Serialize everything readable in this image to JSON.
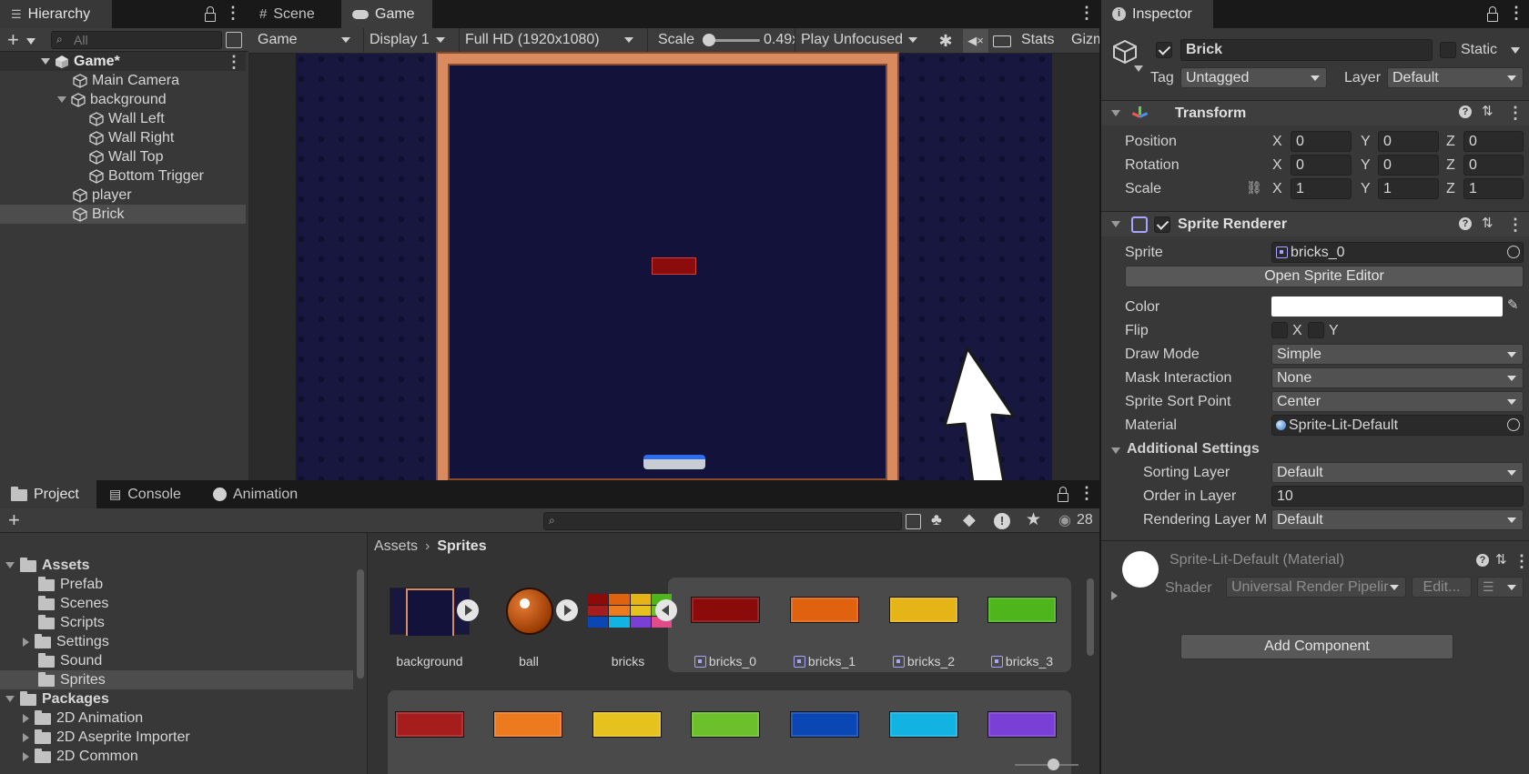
{
  "hierarchy": {
    "tab": "Hierarchy",
    "search_placeholder": "All",
    "items": [
      {
        "label": "Game*"
      },
      {
        "label": "Main Camera"
      },
      {
        "label": "background"
      },
      {
        "label": "Wall Left"
      },
      {
        "label": "Wall Right"
      },
      {
        "label": "Wall Top"
      },
      {
        "label": "Bottom Trigger"
      },
      {
        "label": "player"
      },
      {
        "label": "Brick"
      }
    ]
  },
  "game_view": {
    "tabs": [
      "Scene",
      "Game"
    ],
    "toolbar": {
      "view_mode": "Game",
      "display": "Display 1",
      "resolution": "Full HD (1920x1080)",
      "scale_label": "Scale",
      "scale_value": "0.49x",
      "play_mode": "Play Unfocused",
      "stats": "Stats",
      "gizmos": "Gizm"
    }
  },
  "project": {
    "tabs": [
      "Project",
      "Console",
      "Animation"
    ],
    "visible_count": "28",
    "tree": [
      {
        "label": "Assets"
      },
      {
        "label": "Prefab"
      },
      {
        "label": "Scenes"
      },
      {
        "label": "Scripts"
      },
      {
        "label": "Settings"
      },
      {
        "label": "Sound"
      },
      {
        "label": "Sprites"
      },
      {
        "label": "Packages"
      },
      {
        "label": "2D Animation"
      },
      {
        "label": "2D Aseprite Importer"
      },
      {
        "label": "2D Common"
      }
    ],
    "breadcrumb": {
      "root": "Assets",
      "current": "Sprites"
    },
    "assets": [
      {
        "label": "background"
      },
      {
        "label": "ball"
      },
      {
        "label": "bricks"
      },
      {
        "label": "bricks_0"
      },
      {
        "label": "bricks_1"
      },
      {
        "label": "bricks_2"
      },
      {
        "label": "bricks_3"
      }
    ],
    "brick_colors": [
      "#8b0a0a",
      "#e0620f",
      "#e5b417",
      "#4eb51c"
    ],
    "brick_colors_row2": [
      "#a51d1d",
      "#ee7a1f",
      "#e6c21f",
      "#6cc02c",
      "#0a47b5",
      "#12b3e2",
      "#7a3fd4"
    ]
  },
  "inspector": {
    "tab": "Inspector",
    "object_name": "Brick",
    "static_label": "Static",
    "tag_label": "Tag",
    "tag_value": "Untagged",
    "layer_label": "Layer",
    "layer_value": "Default",
    "transform": {
      "title": "Transform",
      "position_label": "Position",
      "rotation_label": "Rotation",
      "scale_label": "Scale",
      "position": {
        "x": "0",
        "y": "0",
        "z": "0"
      },
      "rotation": {
        "x": "0",
        "y": "0",
        "z": "0"
      },
      "scale": {
        "x": "1",
        "y": "1",
        "z": "1"
      }
    },
    "sprite_renderer": {
      "title": "Sprite Renderer",
      "sprite_label": "Sprite",
      "sprite_value": "bricks_0",
      "open_editor": "Open Sprite Editor",
      "color_label": "Color",
      "color_value": "#ffffff",
      "flip_label": "Flip",
      "flip_x": "X",
      "flip_y": "Y",
      "draw_mode_label": "Draw Mode",
      "draw_mode": "Simple",
      "mask_label": "Mask Interaction",
      "mask": "None",
      "sort_point_label": "Sprite Sort Point",
      "sort_point": "Center",
      "material_label": "Material",
      "material": "Sprite-Lit-Default",
      "additional_title": "Additional Settings",
      "sorting_layer_label": "Sorting Layer",
      "sorting_layer": "Default",
      "order_label": "Order in Layer",
      "order": "10",
      "rendering_label": "Rendering Layer M",
      "rendering": "Default"
    },
    "material": {
      "title": "Sprite-Lit-Default (Material)",
      "shader_label": "Shader",
      "shader": "Universal Render Pipelir",
      "edit": "Edit..."
    },
    "add_component": "Add Component"
  }
}
